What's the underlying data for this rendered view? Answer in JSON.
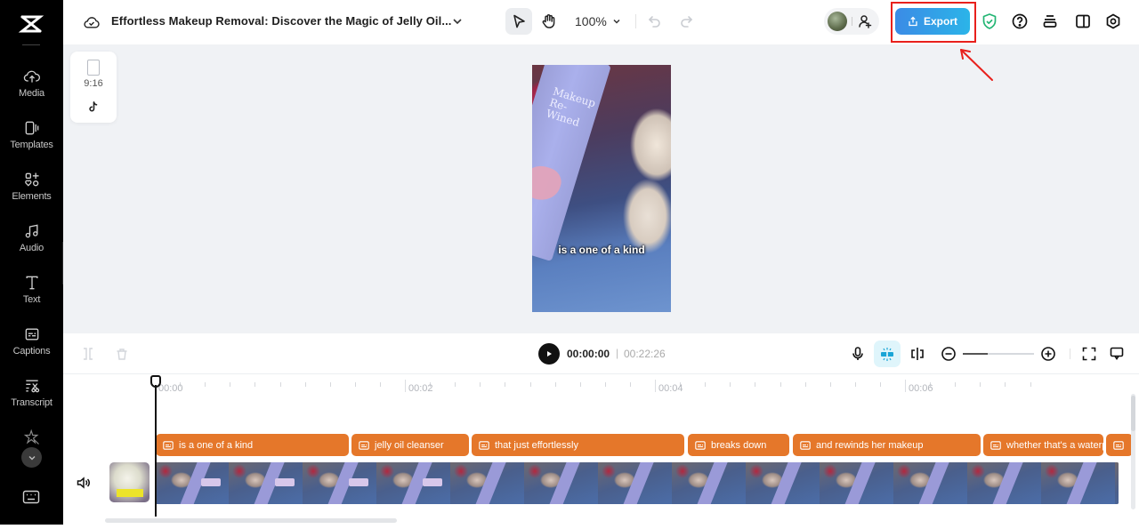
{
  "sidebar": {
    "logo": "capcut-logo",
    "items": [
      {
        "label": "Media",
        "icon": "cloud-upload-icon"
      },
      {
        "label": "Templates",
        "icon": "templates-icon"
      },
      {
        "label": "Elements",
        "icon": "elements-icon"
      },
      {
        "label": "Audio",
        "icon": "music-note-icon"
      },
      {
        "label": "Text",
        "icon": "text-icon"
      },
      {
        "label": "Captions",
        "icon": "captions-icon"
      },
      {
        "label": "Transcript",
        "icon": "transcript-icon"
      },
      {
        "label": "",
        "icon": "magic-star-icon"
      }
    ],
    "more_icon": "chevron-down-icon",
    "keyboard_icon": "keyboard-icon"
  },
  "header": {
    "project_title": "Effortless Makeup Removal: Discover the Magic of Jelly Oil...",
    "zoom_level": "100%",
    "export_label": "Export"
  },
  "canvas": {
    "aspect_ratio": "9:16",
    "platform": "TikTok",
    "video_caption": "is a one of a kind",
    "product_text": "Makeup Re-Wined"
  },
  "playback": {
    "current_time": "00:00:00",
    "separator": "|",
    "total_time": "00:22:26",
    "timeline_zoom_percent": 35
  },
  "timeline": {
    "ruler_labels": [
      "00:00",
      "00:02",
      "00:04",
      "00:06"
    ],
    "caption_clips": [
      {
        "text": "is a one of a kind"
      },
      {
        "text": "jelly oil cleanser"
      },
      {
        "text": "that just effortlessly"
      },
      {
        "text": "breaks down"
      },
      {
        "text": "and rewinds her makeup"
      },
      {
        "text": "whether that's a waterproof"
      },
      {
        "text": ""
      }
    ],
    "clip_color": "#e5772a"
  },
  "colors": {
    "accent": "#3b8be6",
    "highlight_box": "#e8201c",
    "sidebar_bg": "#000000",
    "canvas_bg": "#f0f2f5",
    "shield": "#22b573"
  }
}
